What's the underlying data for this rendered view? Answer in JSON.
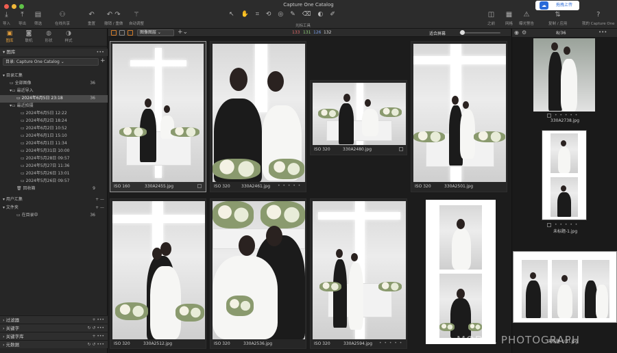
{
  "window": {
    "title": "Capture One Catalog"
  },
  "upload_button": {
    "label": "拖拽上传"
  },
  "toolbar": {
    "import": "导入",
    "export": "导出",
    "filter": "筛选",
    "share": "在线共享",
    "reset": "重置",
    "undo_redo": "撤销 / 重做",
    "auto_adjust": "自动调整",
    "cursor_tools": "光标工具",
    "previous": "之前",
    "grid": "网格",
    "exposure_warning": "曝光警告",
    "copy_apply": "复制 / 应用",
    "my_capture_one": "我的 Capture One"
  },
  "sidebar": {
    "tabs": [
      "图库",
      "联机",
      "形状",
      "样式"
    ],
    "library_header": "图库",
    "catalog_label": "目录: Capture One Catalog",
    "catalog_collection": "目录汇集",
    "items": [
      {
        "label": "全部图像",
        "count": "36"
      },
      {
        "label": "最近导入",
        "count": ""
      },
      {
        "label": "2024年6月5日 23:18",
        "count": "36"
      },
      {
        "label": "最近拍摄",
        "count": ""
      },
      {
        "label": "2024年6月5日 12:22",
        "count": ""
      },
      {
        "label": "2024年6月2日 18:24",
        "count": ""
      },
      {
        "label": "2024年6月2日 10:52",
        "count": ""
      },
      {
        "label": "2024年6月1日 15:10",
        "count": ""
      },
      {
        "label": "2024年6月1日 11:34",
        "count": ""
      },
      {
        "label": "2024年5月31日 10:00",
        "count": ""
      },
      {
        "label": "2024年5月28日 09:57",
        "count": ""
      },
      {
        "label": "2024年5月27日 11:36",
        "count": ""
      },
      {
        "label": "2024年5月26日 13:01",
        "count": ""
      },
      {
        "label": "2024年5月26日 09:57",
        "count": ""
      },
      {
        "label": "回收箱",
        "count": "9"
      }
    ],
    "user_collection": "用户汇集",
    "folders": "文件夹",
    "in_catalog": {
      "label": "在目录中",
      "count": "36"
    },
    "bottom_sections": [
      "过滤器",
      "关键字",
      "关键字库",
      "元数据"
    ]
  },
  "browser": {
    "view_dropdown": "图像图层",
    "rgb": {
      "r": "133",
      "g": "131",
      "b": "126",
      "a": "132"
    },
    "fit_label": "适合屏幕",
    "thumbs": [
      {
        "iso": "ISO 160",
        "name": "330A2455.jpg"
      },
      {
        "iso": "ISO 320",
        "name": "330A2461.jpg"
      },
      {
        "iso": "ISO 320",
        "name": "330A2480.jpg"
      },
      {
        "iso": "ISO 320",
        "name": "330A2501.jpg"
      },
      {
        "iso": "ISO 320",
        "name": "330A2512.jpg"
      },
      {
        "iso": "ISO 320",
        "name": "330A2536.jpg"
      },
      {
        "iso": "ISO 320",
        "name": "330A2594.jpg"
      },
      {
        "iso": "",
        "name": "未标题-1.jpg"
      }
    ],
    "colors": {
      "accent": "#d47d2a",
      "selected_row": "#4a4a4a"
    }
  },
  "right_panel": {
    "counter": "8/36",
    "items": [
      {
        "name": "330A2738.jpg"
      },
      {
        "name": "未标题-1.jpg"
      },
      {
        "name": "未标题-1(1).jpg"
      }
    ]
  },
  "watermark": {
    "text": "MODEL PHOTOGRAPH"
  }
}
